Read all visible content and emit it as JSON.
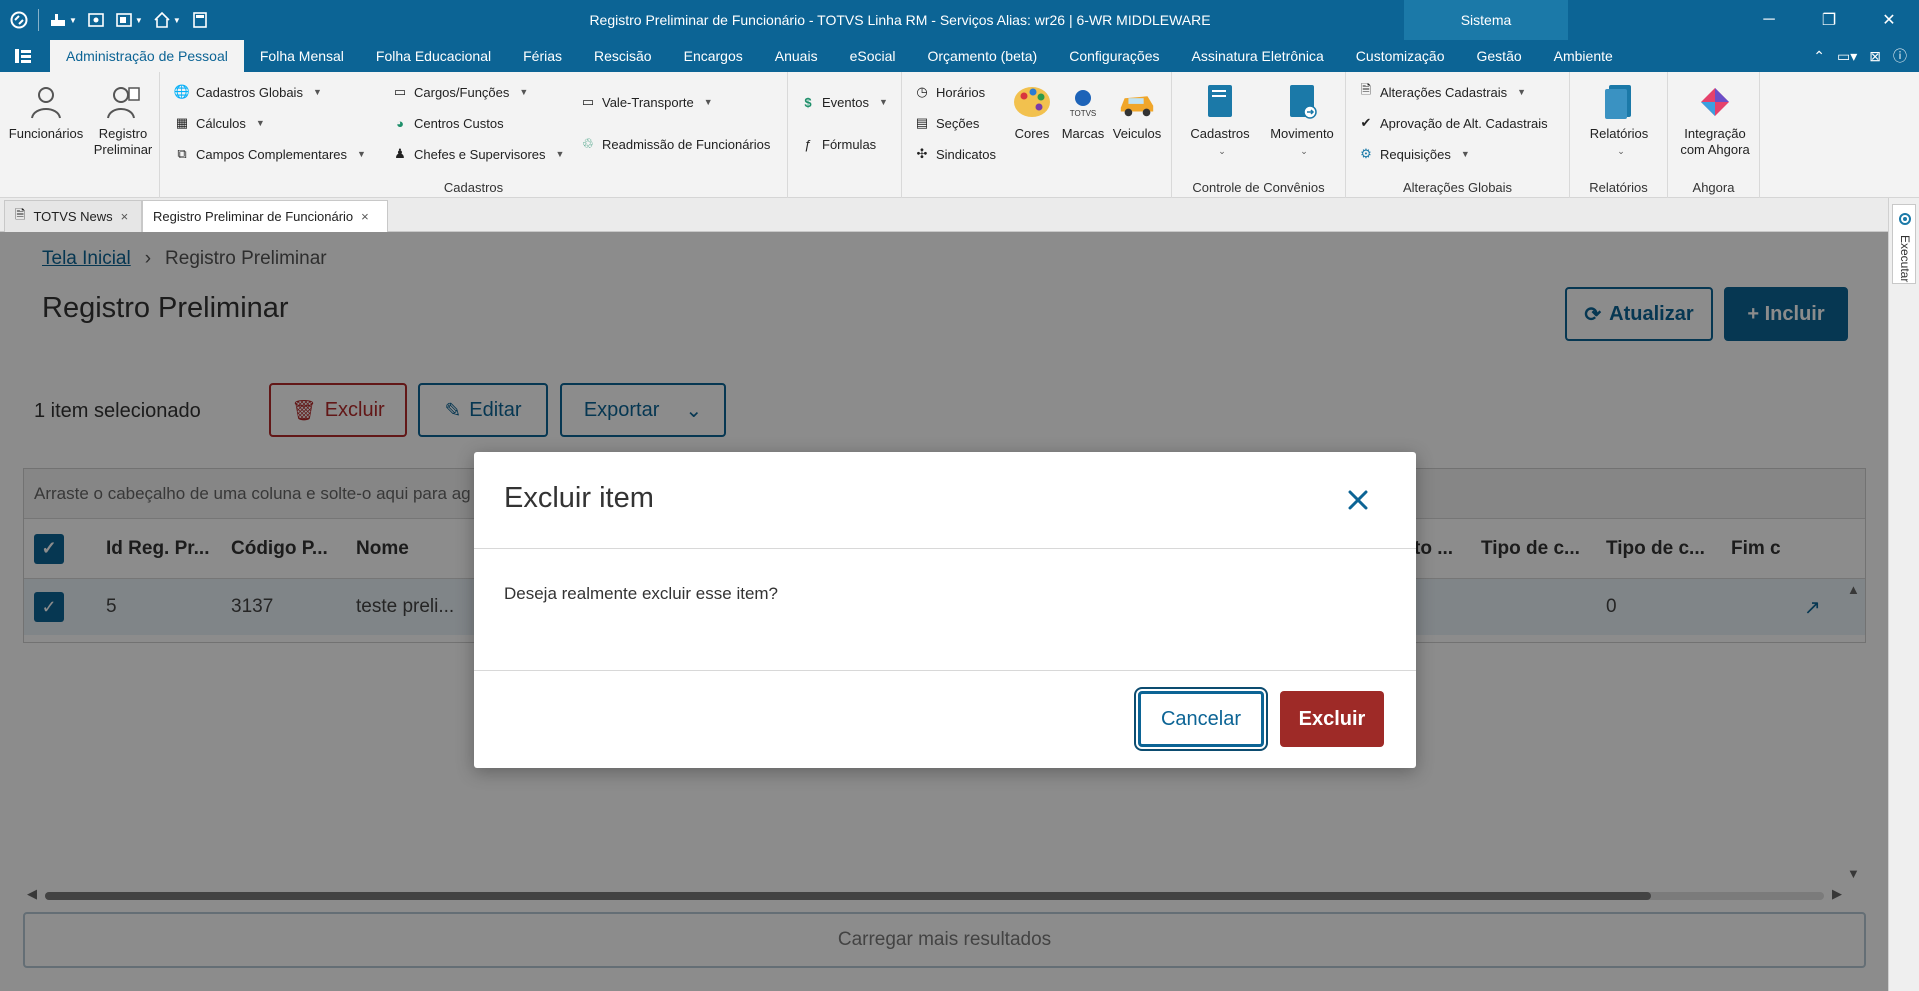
{
  "window": {
    "title": "Registro Preliminar de Funcionário - TOTVS Linha RM - Serviços  Alias: wr26 | 6-WR MIDDLEWARE",
    "sistema_label": "Sistema"
  },
  "menu": {
    "tabs": [
      "Administração de Pessoal",
      "Folha Mensal",
      "Folha Educacional",
      "Férias",
      "Rescisão",
      "Encargos",
      "Anuais",
      "eSocial",
      "Orçamento (beta)",
      "Configurações",
      "Assinatura Eletrônica",
      "Customização",
      "Gestão",
      "Ambiente"
    ],
    "active_index": 0
  },
  "ribbon": {
    "funcionarios": "Funcionários",
    "registro_preliminar": "Registro Preliminar",
    "cadastros_globais": "Cadastros Globais",
    "calculos": "Cálculos",
    "campos_complementares": "Campos Complementares",
    "cargos_funcoes": "Cargos/Funções",
    "centros_custos": "Centros Custos",
    "chefes_supervisores": "Chefes e Supervisores",
    "vale_transporte": "Vale-Transporte",
    "readmissao": "Readmissão de Funcionários",
    "cadastros_group": "Cadastros",
    "eventos": "Eventos",
    "formulas": "Fórmulas",
    "horarios": "Horários",
    "secoes": "Seções",
    "sindicatos": "Sindicatos",
    "cores": "Cores",
    "marcas": "Marcas",
    "veiculos": "Veiculos",
    "cadastros_btn": "Cadastros",
    "movimento": "Movimento",
    "controle_convenios": "Controle de Convênios",
    "alteracoes_cadastrais": "Alterações Cadastrais",
    "aprovacao_alt": "Aprovação de Alt. Cadastrais",
    "requisicoes": "Requisições",
    "alteracoes_globais": "Alterações Globais",
    "relatorios_btn": "Relatórios",
    "relatorios_group": "Relatórios",
    "integracao": "Integração com Ahgora",
    "ahgora_group": "Ahgora",
    "marcas_logo_text": "TOTVS"
  },
  "doc_tabs": {
    "tab1": "TOTVS News",
    "tab2": "Registro Preliminar de Funcionário",
    "close": "×"
  },
  "right_rail": {
    "executar": "Executar"
  },
  "page": {
    "breadcrumb_home": "Tela Inicial",
    "breadcrumb_sep": "›",
    "breadcrumb_current": "Registro Preliminar",
    "title": "Registro Preliminar",
    "atualizar": "Atualizar",
    "incluir": "+ Incluir",
    "selected_count": "1 item selecionado",
    "excluir": "Excluir",
    "editar": "Editar",
    "exportar": "Exportar"
  },
  "grid": {
    "group_hint": "Arraste o cabeçalho de uma coluna e solte-o aqui para ag",
    "headers": {
      "id": "Id Reg. Pr...",
      "codigo": "Código P...",
      "nome": "Nome",
      "hidden": "to ...",
      "tipo1": "Tipo de c...",
      "tipo2": "Tipo de c...",
      "fim": "Fim c"
    },
    "row": {
      "id": "5",
      "codigo": "3137",
      "nome": "teste preli...",
      "tipo2": "0"
    }
  },
  "load_more": "Carregar mais resultados",
  "modal": {
    "title": "Excluir item",
    "message": "Deseja realmente excluir esse item?",
    "cancel": "Cancelar",
    "confirm": "Excluir"
  }
}
